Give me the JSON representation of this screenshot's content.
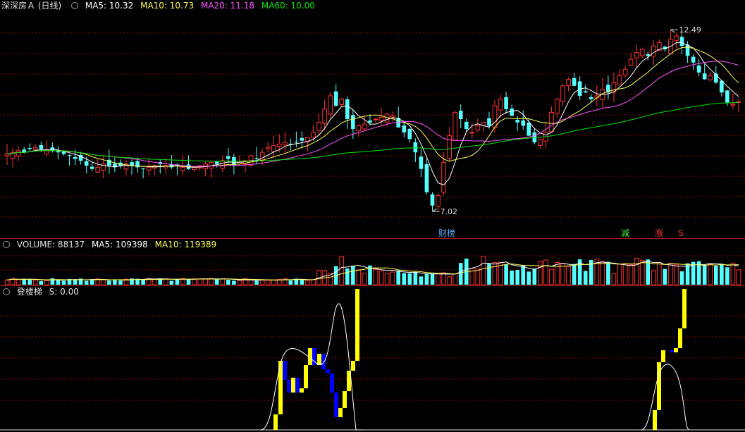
{
  "main_header": {
    "title": "深深房Ａ (日线)",
    "ma5": "MA5: 10.32",
    "ma10": "MA10: 10.73",
    "ma20": "MA20: 11.18",
    "ma60": "MA60: 10.00"
  },
  "annotations": {
    "high": "12.49",
    "low": "7.02",
    "marker_cai": "财榜",
    "marker_jian": "减",
    "marker_zhang": "涨",
    "marker_s": "S"
  },
  "volume_header": {
    "label": "VOLUME: 88137",
    "ma5": "MA5: 109398",
    "ma10": "MA10: 119389"
  },
  "indicator_header": {
    "name": "登楼梯",
    "value": "S: 0.00"
  },
  "colors": {
    "up": "#ff3232",
    "down": "#54ffff",
    "ma5": "#ffffff",
    "ma10": "#ffff54",
    "ma20": "#ff54ff",
    "ma60": "#00e600",
    "ind_rise": "#ffff00",
    "ind_fall": "#0000ff",
    "grid": "#8b0000"
  },
  "chart_data": {
    "type": "candlestick",
    "periods": 130,
    "price_range": [
      6.6,
      13.0
    ],
    "close": [
      8.75,
      8.8,
      8.85,
      8.8,
      8.9,
      8.95,
      8.9,
      8.85,
      8.85,
      8.8,
      8.75,
      8.7,
      8.6,
      8.55,
      8.4,
      8.3,
      8.35,
      8.45,
      8.4,
      8.35,
      8.4,
      8.45,
      8.4,
      8.35,
      8.3,
      8.35,
      8.4,
      8.45,
      8.4,
      8.35,
      8.4,
      8.35,
      8.3,
      8.35,
      8.4,
      8.45,
      8.5,
      8.45,
      8.55,
      8.6,
      8.4,
      8.5,
      8.55,
      8.7,
      8.6,
      8.8,
      8.95,
      9.0,
      9.05,
      9.1,
      9.05,
      9.1,
      9.15,
      9.25,
      9.4,
      9.7,
      10.1,
      10.5,
      10.2,
      10.4,
      9.8,
      9.5,
      9.6,
      9.65,
      9.7,
      9.8,
      9.85,
      9.95,
      9.9,
      9.55,
      9.4,
      9.2,
      8.8,
      8.3,
      7.6,
      7.2,
      7.5,
      8.5,
      9.3,
      10.0,
      9.8,
      9.5,
      9.4,
      9.6,
      9.7,
      9.6,
      10.2,
      10.4,
      10.1,
      9.9,
      9.7,
      9.6,
      9.3,
      9.1,
      9.2,
      9.4,
      10.0,
      10.4,
      10.8,
      11.0,
      10.8,
      10.5,
      10.6,
      10.4,
      10.5,
      10.7,
      10.6,
      10.9,
      11.1,
      11.3,
      11.6,
      11.8,
      11.9,
      11.7,
      12.0,
      12.1,
      11.9,
      12.2,
      12.3,
      12.0,
      11.7,
      11.5,
      11.2,
      11.0,
      11.1,
      10.9,
      10.6,
      10.3,
      10.25,
      10.32
    ],
    "ma": {
      "ma5": 10.32,
      "ma10": 10.73,
      "ma20": 11.18,
      "ma60": 10.0
    },
    "volume": {
      "last": 88137,
      "ma5": 109398,
      "ma10": 119389
    },
    "indicator": {
      "name": "登楼梯",
      "last": 0.0
    }
  }
}
